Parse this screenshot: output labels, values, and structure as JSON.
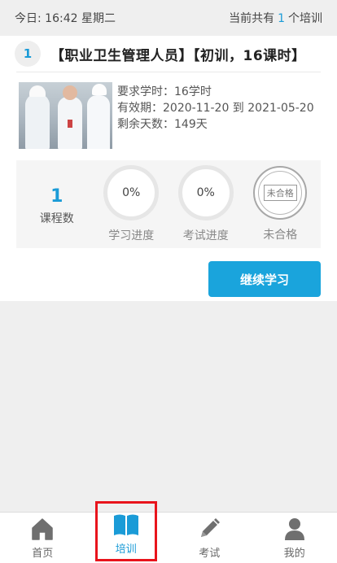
{
  "header": {
    "date_prefix": "今日:",
    "time": "16:42",
    "weekday": "星期二",
    "summary_prefix": "当前共有",
    "training_count": "1",
    "summary_suffix": "个培训"
  },
  "course": {
    "index": "1",
    "title": "【职业卫生管理人员】【初训，16课时】",
    "required_hours": "要求学时：16学时",
    "validity": "有效期：2020-11-20 到 2021-05-20",
    "remaining_days": "剩余天数：149天"
  },
  "stats": {
    "course_count": "1",
    "course_count_label": "课程数",
    "study_progress": "0%",
    "study_progress_label": "学习进度",
    "exam_progress": "0%",
    "exam_progress_label": "考试进度",
    "stamp_text": "未合格",
    "result_label": "未合格"
  },
  "actions": {
    "continue_label": "继续学习"
  },
  "tabbar": {
    "items": [
      {
        "label": "首页",
        "icon": "home-icon"
      },
      {
        "label": "培训",
        "icon": "book-icon"
      },
      {
        "label": "考试",
        "icon": "pencil-icon"
      },
      {
        "label": "我的",
        "icon": "user-icon"
      }
    ],
    "active": "培训"
  },
  "colors": {
    "accent": "#1a9bd7",
    "highlight_border": "#e8141c",
    "button": "#1aa4dc"
  }
}
